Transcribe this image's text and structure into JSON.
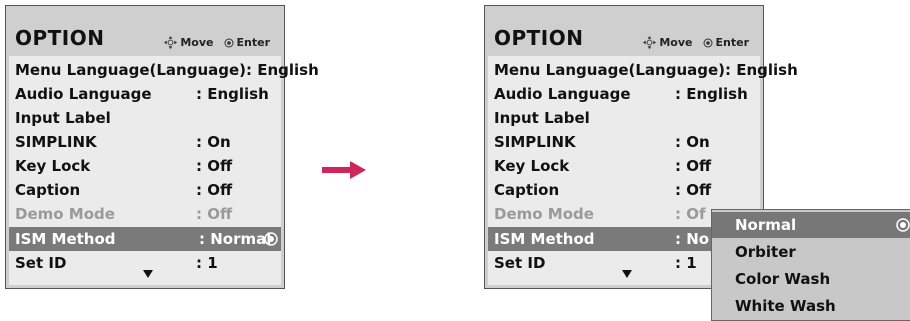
{
  "header": {
    "title": "OPTION",
    "move_label": "Move",
    "enter_label": "Enter"
  },
  "menu_items": [
    {
      "label": "Menu Language(Language): English",
      "value": ""
    },
    {
      "label": "Audio Language",
      "value": ": English"
    },
    {
      "label": "Input Label",
      "value": ""
    },
    {
      "label": "SIMPLINK",
      "value": ": On"
    },
    {
      "label": "Key Lock",
      "value": ": Off"
    },
    {
      "label": "Caption",
      "value": ": Off"
    },
    {
      "label": "Demo Mode",
      "value": ": Off"
    },
    {
      "label": "ISM Method",
      "value": ": Normal"
    },
    {
      "label": "Set ID",
      "value": ": 1"
    }
  ],
  "screen_b": {
    "demo_value_truncated": ": Of",
    "ism_value_truncated": ": No"
  },
  "ism_options": [
    "Normal",
    "Orbiter",
    "Color Wash",
    "White Wash"
  ],
  "selected_option": "Normal",
  "colors": {
    "highlight": "#7a7a7a",
    "arrow": "#d0255a",
    "frame": "#cfcfcf",
    "body": "#ebebeb"
  },
  "icons": [
    "move-icon",
    "enter-icon",
    "radio-selected-icon",
    "down-arrow-icon",
    "right-arrow-icon"
  ]
}
